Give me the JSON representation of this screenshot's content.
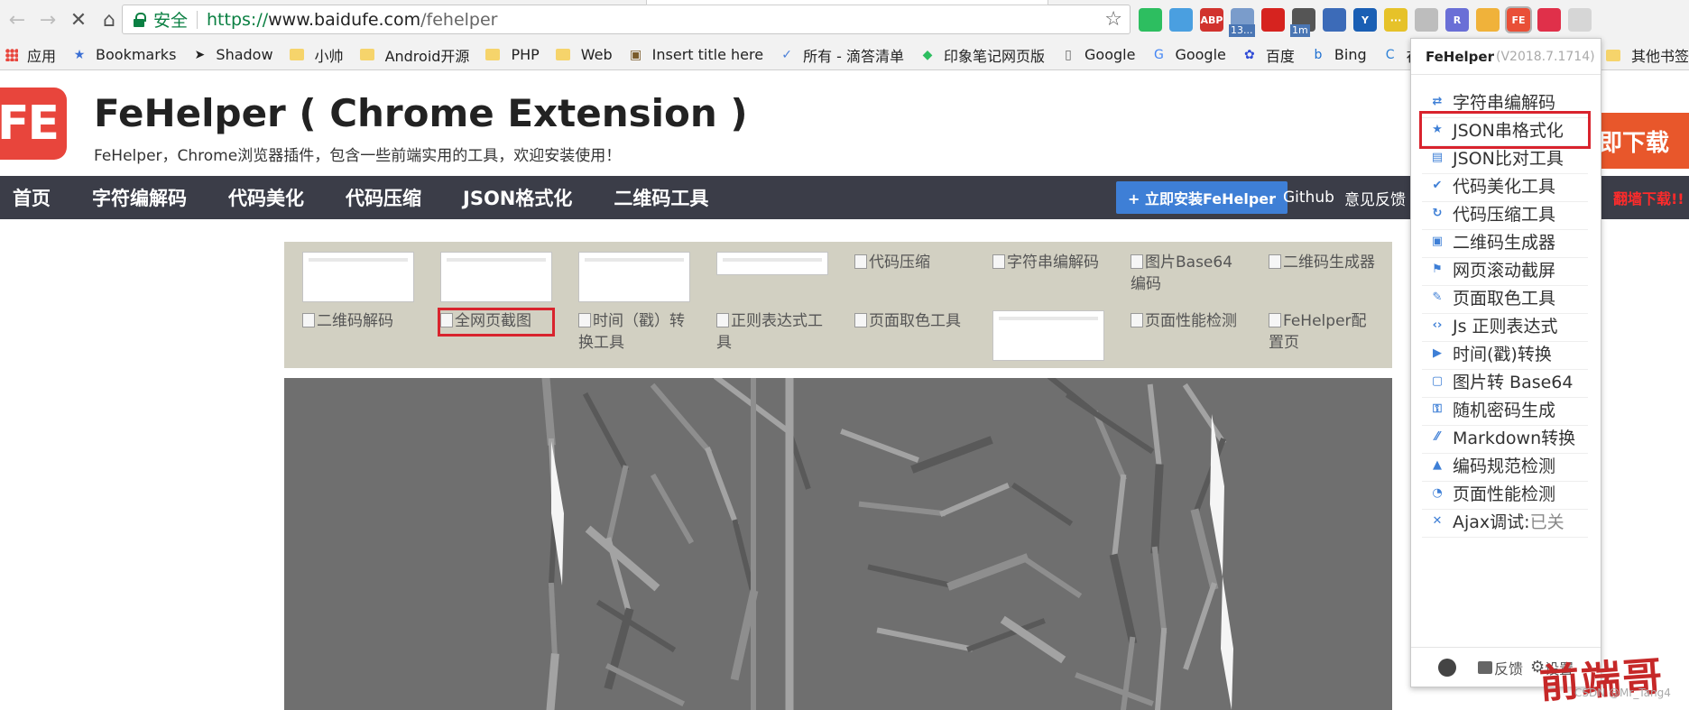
{
  "browser": {
    "address": {
      "secure_label": "安全",
      "url_scheme": "https://",
      "url_host": "www.baidufe.com",
      "url_path": "/fehelper"
    },
    "extensions": [
      {
        "icon": "evernote-icon",
        "color": "#2dbe60",
        "label": ""
      },
      {
        "icon": "check-circle-icon",
        "color": "#4a9fe0",
        "label": ""
      },
      {
        "icon": "adblock-plus-icon",
        "color": "#d1332e",
        "label": "ABP"
      },
      {
        "icon": "weather-icon",
        "color": "#7a9ccb",
        "label": "",
        "badge": "13..."
      },
      {
        "icon": "opera-icon",
        "color": "#d6231f",
        "label": ""
      },
      {
        "icon": "timer-icon",
        "color": "#555555",
        "label": "",
        "badge": "1m"
      },
      {
        "icon": "globe-icon",
        "color": "#3c6bb8",
        "label": ""
      },
      {
        "icon": "y-icon",
        "color": "#1a5fb4",
        "label": "Y"
      },
      {
        "icon": "notes-icon",
        "color": "#e6c229",
        "label": "···"
      },
      {
        "icon": "tree-icon",
        "color": "#bdbdbd",
        "label": ""
      },
      {
        "icon": "r-hex-icon",
        "color": "#6a6fd6",
        "label": "R"
      },
      {
        "icon": "face-icon",
        "color": "#f0b23a",
        "label": ""
      },
      {
        "icon": "fehelper-icon",
        "color": "#e94f37",
        "label": "FE",
        "active": true
      },
      {
        "icon": "red-app-icon",
        "color": "#e0304a",
        "label": ""
      },
      {
        "icon": "grey-icon",
        "color": "#d6d6d6",
        "label": ""
      }
    ],
    "bookmarks": [
      {
        "icon": "apps-icon",
        "label": "应用"
      },
      {
        "icon": "star-icon",
        "label": "Bookmarks"
      },
      {
        "icon": "cursor-icon",
        "label": "Shadow"
      },
      {
        "icon": "folder-icon",
        "label": "小帅"
      },
      {
        "icon": "folder-icon",
        "label": "Android开源"
      },
      {
        "icon": "folder-icon",
        "label": "PHP"
      },
      {
        "icon": "folder-icon",
        "label": "Web"
      },
      {
        "icon": "image-icon",
        "label": "Insert title here"
      },
      {
        "icon": "check-icon",
        "label": "所有 - 滴答清单"
      },
      {
        "icon": "evernote-icon",
        "label": "印象笔记网页版"
      },
      {
        "icon": "page-icon",
        "label": "Google"
      },
      {
        "icon": "google-icon",
        "label": "Google"
      },
      {
        "icon": "baidu-paw-icon",
        "label": "百度"
      },
      {
        "icon": "bing-icon",
        "label": "Bing"
      },
      {
        "icon": "c-icon",
        "label": "在线代码看"
      }
    ],
    "bookmarks_other": "其他书签"
  },
  "site": {
    "logo": "FE",
    "title": "FeHelper ( Chrome Extension )",
    "subtitle": "FeHelper，Chrome浏览器插件，包含一些前端实用的工具，欢迎安装使用！",
    "download_label": "即下载",
    "nav": [
      "首页",
      "字符编解码",
      "代码美化",
      "代码压缩",
      "JSON格式化",
      "二维码工具"
    ],
    "install_label": "+ 立即安装FeHelper",
    "github_label": "Github",
    "feedback_label": "意见反馈",
    "fanqiang_label": "翻墙下载!!"
  },
  "thumbnails": [
    {
      "type": "image",
      "label": ""
    },
    {
      "type": "image",
      "label": ""
    },
    {
      "type": "image",
      "label": ""
    },
    {
      "type": "image",
      "label": ""
    },
    {
      "type": "broken",
      "label": "代码压缩"
    },
    {
      "type": "broken",
      "label": "字符串编解码"
    },
    {
      "type": "broken",
      "label": "图片Base64编码"
    },
    {
      "type": "broken",
      "label": "二维码生成器"
    },
    {
      "type": "broken",
      "label": "二维码解码"
    },
    {
      "type": "broken",
      "label": "全网页截图",
      "highlighted": true
    },
    {
      "type": "broken",
      "label": "时间（戳）转换工具"
    },
    {
      "type": "broken",
      "label": "正则表达式工具"
    },
    {
      "type": "broken",
      "label": "页面取色工具"
    },
    {
      "type": "image",
      "label": ""
    },
    {
      "type": "broken",
      "label": "页面性能检测"
    },
    {
      "type": "broken",
      "label": "FeHelper配置页"
    }
  ],
  "popup": {
    "name": "FeHelper",
    "version": "(V2018.7.1714)",
    "items": [
      {
        "icon": "swap-icon",
        "label": "字符串编解码"
      },
      {
        "icon": "star-icon",
        "label": "JSON串格式化",
        "selected": true
      },
      {
        "icon": "table-icon",
        "label": "JSON比对工具"
      },
      {
        "icon": "check-icon",
        "label": "代码美化工具"
      },
      {
        "icon": "refresh-icon",
        "label": "代码压缩工具"
      },
      {
        "icon": "qrcode-icon",
        "label": "二维码生成器"
      },
      {
        "icon": "flag-icon",
        "label": "网页滚动截屏"
      },
      {
        "icon": "pen-icon",
        "label": "页面取色工具"
      },
      {
        "icon": "code-icon",
        "label": "Js 正则表达式"
      },
      {
        "icon": "play-icon",
        "label": "时间(戳)转换"
      },
      {
        "icon": "image-icon",
        "label": "图片转 Base64"
      },
      {
        "icon": "key-icon",
        "label": "随机密码生成"
      },
      {
        "icon": "markdown-icon",
        "label": "Markdown转换"
      },
      {
        "icon": "warning-icon",
        "label": "编码规范检测"
      },
      {
        "icon": "clock-icon",
        "label": "页面性能检测"
      },
      {
        "icon": "close-icon",
        "label": "Ajax调试:",
        "state": "已关"
      }
    ],
    "footer": {
      "feedback": "反馈",
      "settings": "设置"
    }
  },
  "watermark": "前端哥",
  "csdn_mark": "CSDN @Mr_Tang4"
}
